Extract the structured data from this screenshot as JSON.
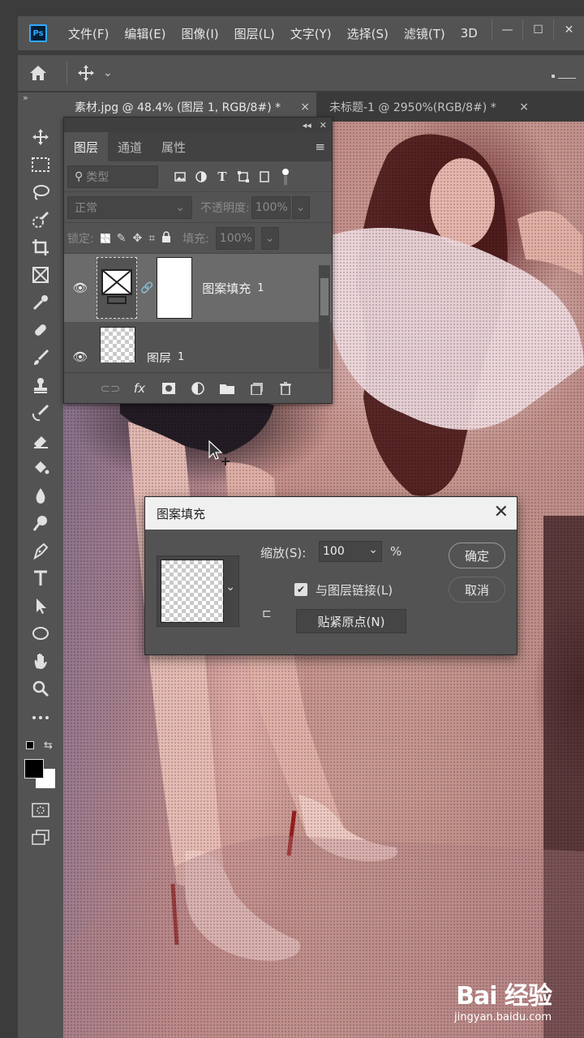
{
  "app": {
    "logo": "Ps"
  },
  "menubar": {
    "items": [
      "文件(F)",
      "编辑(E)",
      "图像(I)",
      "图层(L)",
      "文字(Y)",
      "选择(S)",
      "滤镜(T)",
      "3D"
    ],
    "window_controls": {
      "minimize": "—",
      "restore": "☐",
      "close": "✕"
    }
  },
  "options_bar": {
    "home_icon": "home-icon",
    "move_icon": "move-icon",
    "dropdown": "⌄"
  },
  "tabs": [
    {
      "label": "素材.jpg @ 48.4% (图层 1, RGB/8#) *",
      "close": "×"
    },
    {
      "label": "未标题-1 @ 2950%(RGB/8#) *",
      "close": "×"
    }
  ],
  "toolbar": {
    "collapse": "»",
    "tools": [
      "move-tool",
      "marquee-tool",
      "lasso-tool",
      "quick-select-tool",
      "crop-tool",
      "frame-tool",
      "eyedropper-tool",
      "healing-brush-tool",
      "brush-tool",
      "clone-stamp-tool",
      "history-brush-tool",
      "eraser-tool",
      "paint-bucket-tool",
      "blur-tool",
      "dodge-tool",
      "pen-tool",
      "type-tool",
      "path-select-tool",
      "ellipse-tool",
      "hand-tool",
      "zoom-tool",
      "more-tools",
      "swap-colors",
      "foreground-color",
      "quick-mask",
      "screen-mode"
    ]
  },
  "layers_panel": {
    "top_controls": {
      "collapse": "◂◂",
      "close": "✕"
    },
    "tabs": [
      "图层",
      "通道",
      "属性"
    ],
    "active_tab": "图层",
    "menu": "≡",
    "filter": {
      "placeholder": "类型"
    },
    "blend_mode": "正常",
    "opacity_label": "不透明度:",
    "opacity_value": "100%",
    "lock_label": "锁定:",
    "fill_label": "填充:",
    "fill_value": "100%",
    "layers": [
      {
        "name": "图案填充",
        "suffix": "1",
        "selected": true
      },
      {
        "name": "图层",
        "suffix": "1",
        "selected": false
      }
    ],
    "bottom_icons": [
      "link-icon",
      "fx-icon",
      "mask-icon",
      "adjustment-icon",
      "folder-icon",
      "new-layer-icon",
      "trash-icon"
    ],
    "fx_label": "fx"
  },
  "dialog": {
    "title": "图案填充",
    "close": "✕",
    "scale_label": "缩放(S):",
    "scale_value": "100",
    "scale_unit": "%",
    "link_label": "与图层链接(L)",
    "link_checked": true,
    "snap_label": "贴紧原点(N)",
    "ok_label": "确定",
    "cancel_label": "取消"
  },
  "watermark": {
    "logo": "Bai 经验",
    "url": "jingyan.baidu.com"
  }
}
